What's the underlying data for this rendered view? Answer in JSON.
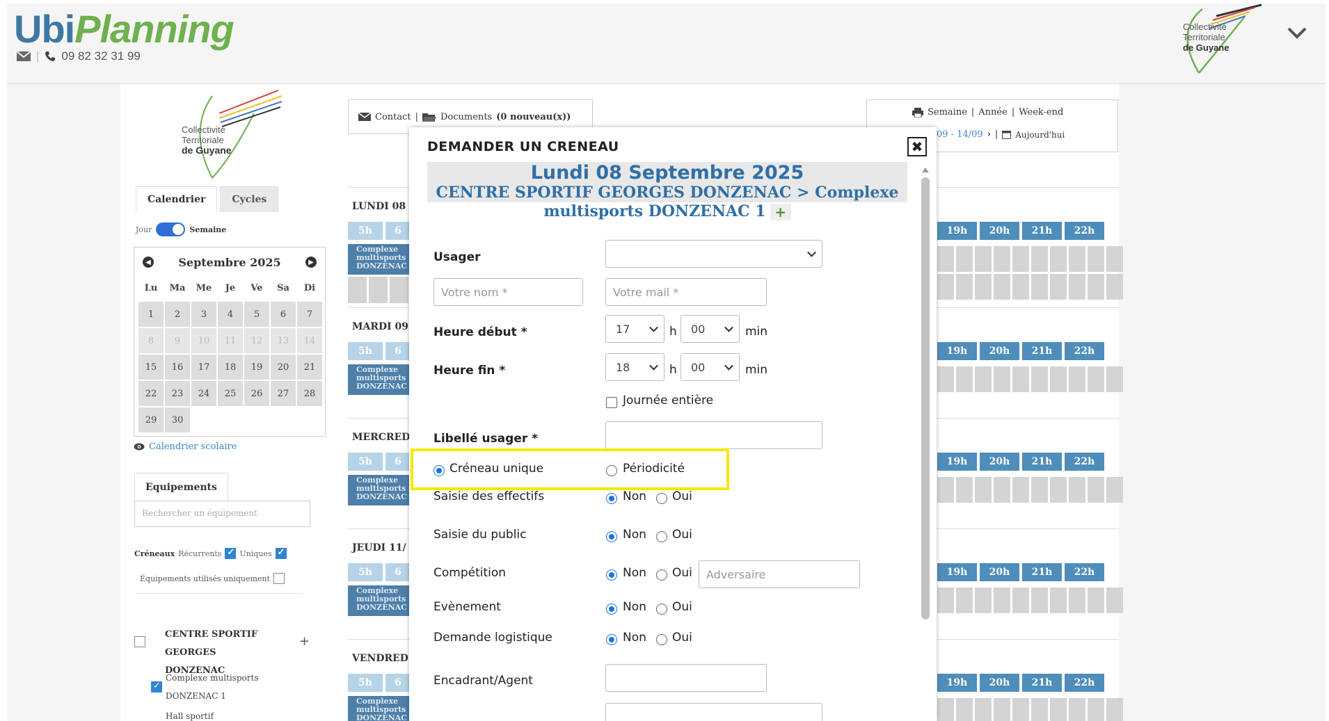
{
  "header": {
    "logo_ubi": "Ubi",
    "logo_planning": "Planning",
    "phone": "09 82 32 31 99",
    "org_line1": "Collectivité",
    "org_line2": "Territoriale",
    "org_line3": "de Guyane"
  },
  "sidebar": {
    "tabs": [
      {
        "label": "Calendrier"
      },
      {
        "label": "Cycles"
      }
    ],
    "toggle_left": "Jour",
    "toggle_right": "Semaine",
    "calendar": {
      "month": "Septembre 2025",
      "dow": [
        "Lu",
        "Ma",
        "Me",
        "Je",
        "Ve",
        "Sa",
        "Di"
      ],
      "days": [
        "1",
        "2",
        "3",
        "4",
        "5",
        "6",
        "7",
        "8",
        "9",
        "10",
        "11",
        "12",
        "13",
        "14",
        "15",
        "16",
        "17",
        "18",
        "19",
        "20",
        "21",
        "22",
        "23",
        "24",
        "25",
        "26",
        "27",
        "28",
        "29",
        "30"
      ]
    },
    "school_calendar_link": "Calendrier scolaire",
    "equipment_tab": "Equipements",
    "equipment_search_placeholder": "Rechercher un équipement",
    "creneaux_label": "Créneaux",
    "recurrents_label": "Récurrents",
    "uniques_label": "Uniques",
    "used_only_label": "Équipements utilisés uniquement",
    "tree_title": "CENTRE SPORTIF GEORGES DONZENAC",
    "tree_item": "Complexe multisports DONZENAC 1",
    "tree_item2": "Hall sportif"
  },
  "toolbar": {
    "contact": "Contact",
    "documents": "Documents",
    "documents_count": "(0 nouveau(x))",
    "semaine": "Semaine",
    "annee": "Année",
    "weekend": "Week-end",
    "range": "09 - 14/09",
    "today": "Aujourd'hui",
    "sep": "|"
  },
  "schedule": {
    "days": [
      "LUNDI 08",
      "MARDI 09",
      "MERCRED",
      "JEUDI 11/",
      "VENDRED"
    ],
    "hours_left": [
      "5h",
      "6"
    ],
    "hours_right": [
      "19h",
      "20h",
      "21h",
      "22h"
    ],
    "slot_text": "Complexe multisports DONZENAC"
  },
  "modal": {
    "title": "DEMANDER UN CRENEAU",
    "close": "✖",
    "date": "Lundi 08 Septembre 2025",
    "location": "CENTRE SPORTIF GEORGES DONZENAC > Complexe multisports DONZENAC 1",
    "plus": "+",
    "usager_label": "Usager",
    "name_placeholder": "Votre nom *",
    "mail_placeholder": "Votre mail *",
    "start_label": "Heure début *",
    "start_hour": "17",
    "start_min": "00",
    "end_label": "Heure fin *",
    "end_hour": "18",
    "end_min": "00",
    "h": "h",
    "min": "min",
    "full_day": "Journée entière",
    "libelle_label": "Libellé usager *",
    "unique_label": "Créneau unique",
    "periodic_label": "Périodicité",
    "effectifs_label": "Saisie des effectifs",
    "public_label": "Saisie du public",
    "competition_label": "Compétition",
    "adversaire_placeholder": "Adversaire",
    "event_label": "Evènement",
    "logistique_label": "Demande logistique",
    "encadrant_label": "Encadrant/Agent",
    "non": "Non",
    "oui": "Oui"
  }
}
